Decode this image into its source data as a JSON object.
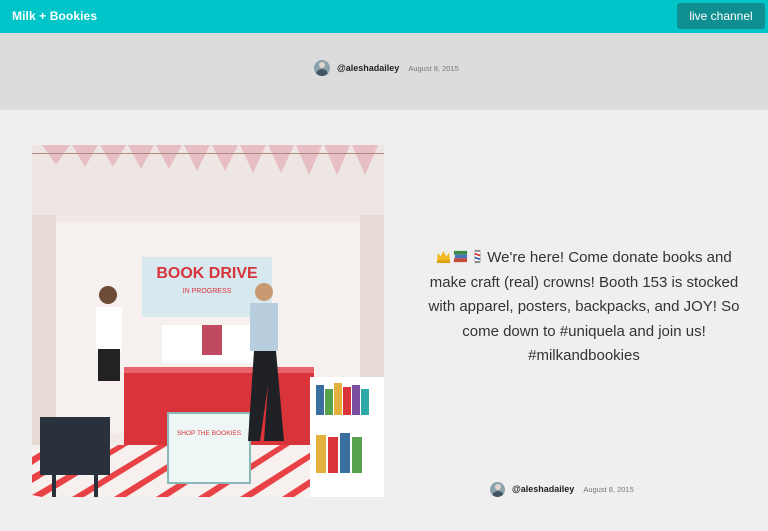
{
  "app": {
    "brand": "Milk + Bookies",
    "live_button_label": "live channel"
  },
  "header_user": {
    "handle": "@aleshadailey",
    "date": "August 8, 2015"
  },
  "post": {
    "caption": "We're here! Come donate books and make craft (real) crowns! Booth 153 is stocked with apparel, posters, backpacks, and JOY! So come down to #uniquela and join us! #milkandbookies",
    "emojis": [
      "crown-icon",
      "books-icon",
      "barber-pole-icon"
    ],
    "handle": "@aleshadailey",
    "date": "August 8, 2015",
    "image": {
      "banner_text": "BOOK DRIVE",
      "banner_subtext": "IN PROGRESS",
      "bin_text": "SHOP THE BOOKIES",
      "colors": {
        "accent": "#d8343a",
        "teal": "#00c5c8",
        "wall": "#f1eae7"
      }
    }
  }
}
